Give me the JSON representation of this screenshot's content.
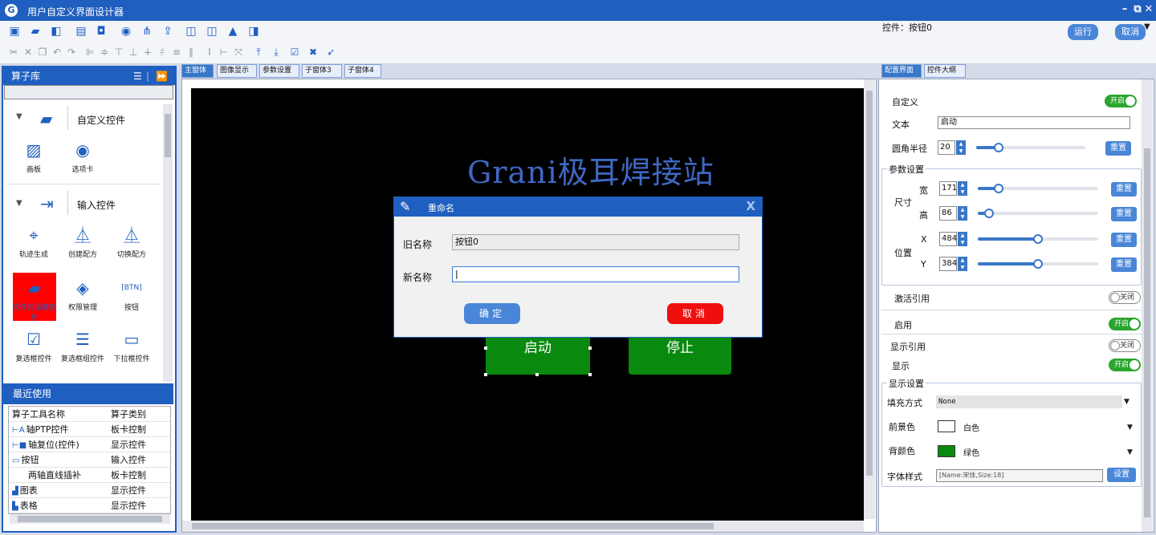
{
  "window": {
    "title": "用户自定义界面设计器",
    "icon": "G"
  },
  "toolbar": {
    "run_label": "运行",
    "cancel_label": "取消",
    "control_prefix": "控件：",
    "control_name": "按钮0"
  },
  "library": {
    "header": "算子库",
    "sections": [
      {
        "label": "自定义控件",
        "tools": [
          "画板",
          "选项卡"
        ]
      },
      {
        "label": "输入控件",
        "tools": [
          "轨迹生成",
          "创建配方",
          "切换配方",
          "文件对话框控件",
          "权限管理",
          "按钮",
          "复选框控件",
          "复选框组控件",
          "下拉框控件"
        ]
      }
    ]
  },
  "recent": {
    "header": "最近使用",
    "columns": [
      "算子工具名称",
      "算子类别"
    ],
    "rows": [
      {
        "name": "轴PTP控件",
        "category": "板卡控制",
        "icon": "axis-ptp-icon"
      },
      {
        "name": "轴复位(控件)",
        "category": "显示控件",
        "icon": "axis-reset-icon"
      },
      {
        "name": "按钮",
        "category": "输入控件",
        "icon": "button-icon"
      },
      {
        "name": "两轴直线插补",
        "category": "板卡控制",
        "icon": ""
      },
      {
        "name": "图表",
        "category": "显示控件",
        "icon": "chart-icon"
      },
      {
        "name": "表格",
        "category": "显示控件",
        "icon": "table-icon"
      }
    ]
  },
  "center_tabs": [
    "主窗体",
    "图像显示",
    "参数设置",
    "子窗体3",
    "子窗体4"
  ],
  "canvas": {
    "title": "Grani极耳焊接站",
    "start_label": "启动",
    "stop_label": "停止",
    "background": "#000000",
    "button_color": "#098a0e"
  },
  "dialog": {
    "title": "重命名",
    "old_label": "旧名称",
    "old_value": "按钮0",
    "new_label": "新名称",
    "new_value": "",
    "ok_label": "确定",
    "cancel_label": "取消",
    "ok_color": "#4a86d8",
    "cancel_color": "#ef0f0f"
  },
  "props": {
    "tabs": [
      "配置界面",
      "控件大纲"
    ],
    "custom_label": "自定义",
    "custom_toggle": "开启",
    "text_label": "文本",
    "text_value": "启动",
    "radius_label": "圆角半径",
    "radius_value": "20",
    "reset_label": "重置",
    "param_group": "参数设置",
    "size_label": "尺寸",
    "width_label": "宽",
    "width_value": "171",
    "height_label": "高",
    "height_value": "86",
    "pos_label": "位置",
    "x_label": "X",
    "x_value": "484",
    "y_label": "Y",
    "y_value": "384",
    "activate_ref_label": "激活引用",
    "activate_ref_toggle": "关闭",
    "enable_label": "启用",
    "enable_toggle": "开启",
    "display_ref_label": "显示引用",
    "display_ref_toggle": "关闭",
    "display_label": "显示",
    "display_toggle": "开启",
    "display_group": "显示设置",
    "fill_label": "填充方式",
    "fill_value": "None",
    "fg_label": "前景色",
    "fg_value": "白色",
    "fg_color": "#ffffff",
    "bg_label": "背颜色",
    "bg_value": "绿色",
    "bg_color": "#098a0e",
    "font_label": "字体样式",
    "font_value": "[Name:宋体,Size:18]",
    "set_label": "设置"
  }
}
